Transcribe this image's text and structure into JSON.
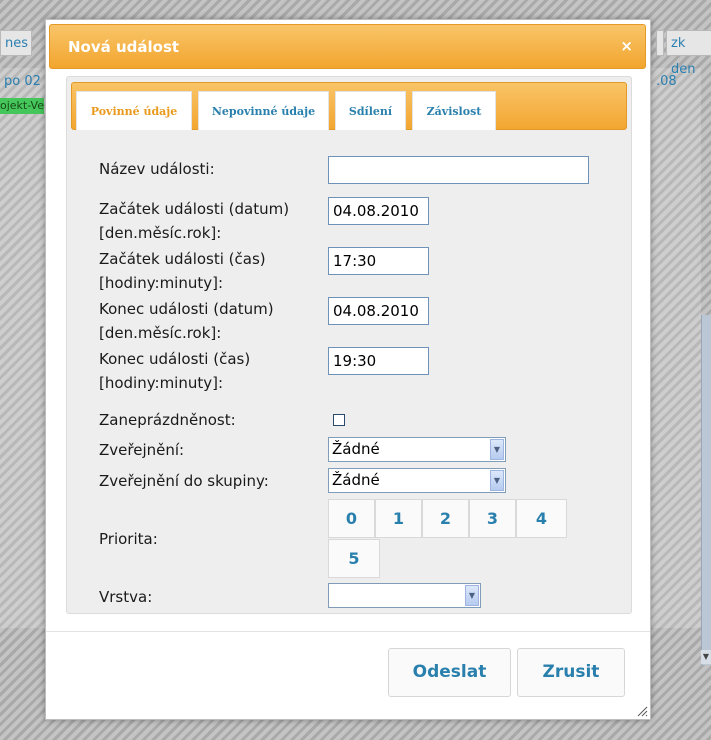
{
  "background": {
    "left_button": "nes",
    "right_button": "zk den",
    "left_header": "po 02",
    "right_header": ".08",
    "green_event": "ojekt-Ve"
  },
  "dialog": {
    "title": "Nová událost",
    "close_symbol": "×",
    "tabs": [
      {
        "label": "Povinné údaje",
        "active": true
      },
      {
        "label": "Nepovinné údaje",
        "active": false
      },
      {
        "label": "Sdílení",
        "active": false
      },
      {
        "label": "Závislost",
        "active": false
      }
    ],
    "fields": {
      "name_label": "Název události:",
      "name_value": "",
      "start_date_label_1": "Začátek události (datum)",
      "start_date_label_2": "[den.měsíc.rok]:",
      "start_date_value": "04.08.2010",
      "start_time_label_1": "Začátek události (čas)",
      "start_time_label_2": "[hodiny:minuty]:",
      "start_time_value": "17:30",
      "end_date_label_1": "Konec události (datum)",
      "end_date_label_2": "[den.měsíc.rok]:",
      "end_date_value": "04.08.2010",
      "end_time_label_1": "Konec události (čas)",
      "end_time_label_2": "[hodiny:minuty]:",
      "end_time_value": "19:30",
      "busy_label": "Zaneprázdněnost:",
      "busy_checked": false,
      "publish_label": "Zveřejnění:",
      "publish_value": "Žádné",
      "publish_group_label": "Zveřejnění do skupiny:",
      "publish_group_value": "Žádné",
      "priority_label": "Priorita:",
      "priority_options": [
        "0",
        "1",
        "2",
        "3",
        "4",
        "5"
      ],
      "layer_label": "Vrstva:",
      "layer_value": ""
    },
    "buttons": {
      "submit": "Odeslat",
      "cancel": "Zrusit"
    },
    "colors": {
      "accent_orange": "#f3a631",
      "link_blue": "#2a80ad"
    }
  }
}
